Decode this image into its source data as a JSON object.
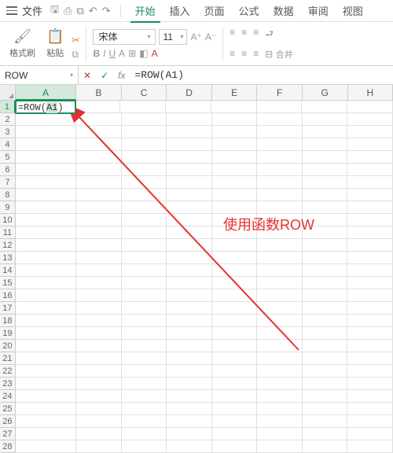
{
  "menu": {
    "file": "文件",
    "tabs": [
      "开始",
      "插入",
      "页面",
      "公式",
      "数据",
      "审阅",
      "视图"
    ],
    "active_tab": 0
  },
  "toolbar": {
    "format_painter": "格式刷",
    "paste": "粘贴",
    "font_name": "宋体",
    "font_size": "11",
    "merge": "合并"
  },
  "formula_bar": {
    "name_box": "ROW",
    "formula": "=ROW(A1)"
  },
  "grid": {
    "columns": [
      "A",
      "B",
      "C",
      "D",
      "E",
      "F",
      "G",
      "H"
    ],
    "row_count": 28,
    "active_cell": {
      "row": 1,
      "col": "A",
      "display_prefix": "=ROW(",
      "display_ref": "A1",
      "display_suffix": ")"
    }
  },
  "annotation": {
    "text": "使用函数ROW",
    "color": "#e63030"
  }
}
